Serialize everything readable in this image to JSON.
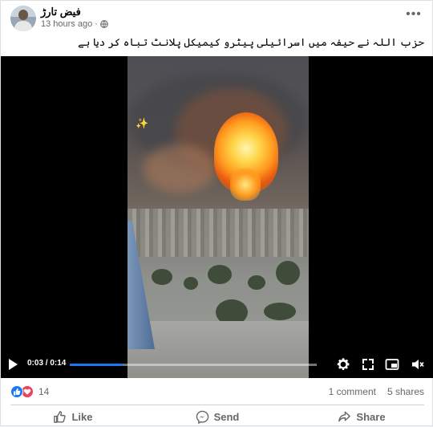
{
  "post": {
    "author": "فیض تارڑ",
    "time": "13 hours ago",
    "separator": "·",
    "more_label": "•••",
    "caption": "حزب اللہ نے حیفہ میں اسرائیلی پیٹرو کیمیکل پلانٹ تباہ کر دیا ہے"
  },
  "video": {
    "time_display": "0:03 / 0:14",
    "progress_fraction": 0.2143,
    "sparkle": "✨"
  },
  "engagement": {
    "reaction_count": "14",
    "comments": "1 comment",
    "shares": "5 shares"
  },
  "actions": {
    "like": "Like",
    "send": "Send",
    "share": "Share"
  },
  "colors": {
    "accent": "#1877f2",
    "love": "#f33e58",
    "secondary_text": "#65676b"
  },
  "icons": [
    "globe-icon",
    "more-icon",
    "play-icon",
    "settings-icon",
    "fullscreen-icon",
    "pip-icon",
    "volume-icon",
    "like-icon",
    "love-icon",
    "messenger-icon",
    "share-icon"
  ]
}
